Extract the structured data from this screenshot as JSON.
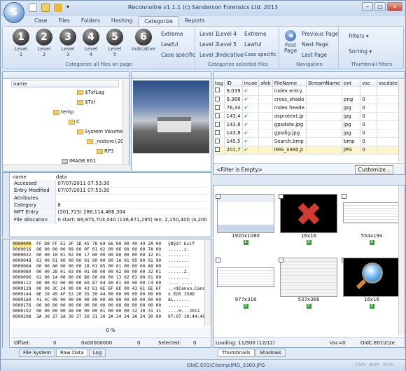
{
  "window": {
    "title": "Reconnoitre v1.1.1 (c) Sanderson Forensics Ltd. 2013"
  },
  "tabs": [
    "Case",
    "Files",
    "Folders",
    "Hashing",
    "Categorize",
    "Reports"
  ],
  "ribbon": {
    "levels": [
      {
        "num": "1",
        "label": "Level\n1"
      },
      {
        "num": "2",
        "label": "Level\n2"
      },
      {
        "num": "3",
        "label": "Level\n3"
      },
      {
        "num": "4",
        "label": "Level\n4"
      },
      {
        "num": "5",
        "label": "Level\n5"
      },
      {
        "num": "6",
        "label": "Indicative"
      }
    ],
    "extreme": "Extreme",
    "lawful": "Lawful",
    "case_specific": "Case specific",
    "group1_label": "Categorize all files on page",
    "sel_levels": [
      "Level 1",
      "Level 4",
      "Level 2",
      "Level 5",
      "Level 3",
      "Indicative"
    ],
    "group2_label": "Categorize selected files",
    "first_page": "First\nPage",
    "prev_page": "Previous Page",
    "next_page": "Next Page",
    "last_page": "Last Page",
    "nav_label": "Navigation",
    "filters": "Filters",
    "sorting": "Sorting",
    "thumb_label": "Thumbnail filters"
  },
  "tree": {
    "header": "name",
    "rows": [
      "$TxfLog",
      "$Txf",
      "temp",
      "C",
      "System Volume In",
      "_restore{2O",
      "RP3",
      "IMAGE.E01"
    ]
  },
  "files": {
    "columns": [
      "tag",
      "ID",
      "inuse",
      "sfok",
      "FileName",
      "StreamName",
      "ext",
      "vsc",
      "vscdate"
    ],
    "rows": [
      [
        "9,039",
        "index entry.",
        "",
        "",
        ""
      ],
      [
        "9,388",
        "cross_shado",
        "",
        "png",
        "0"
      ],
      [
        "76,34",
        "index heade",
        "",
        "jpg",
        "0"
      ],
      [
        "143,4",
        "asprotext.jp",
        "",
        "jpg",
        "0"
      ],
      [
        "143,8",
        "gpsdate.jpg",
        "",
        "jpg",
        "0"
      ],
      [
        "143,8",
        "gpsdig.jpg",
        "",
        "jpg",
        "0"
      ],
      [
        "145,5",
        "Search.bmp",
        "",
        "bmp",
        "0"
      ],
      [
        "201,7",
        "IMG_3360.JI",
        "",
        "JPG",
        "0"
      ]
    ],
    "filter": "<Filter is Empty>",
    "customize": "Customize..."
  },
  "props": {
    "header": [
      "name",
      "data"
    ],
    "rows": [
      [
        "Accessed",
        "07/07/2011 07:53:30"
      ],
      [
        "Entry Modified",
        "07/07/2011 07:53:30"
      ],
      [
        "Attributes",
        ""
      ],
      [
        "Category",
        "8"
      ],
      [
        "MFT Entry",
        "(201,723) 286,114,466,304"
      ],
      [
        "File allocation",
        "0 start: 69,975,703,040 (136,671,295) len: 2,150,400 (4,200"
      ]
    ]
  },
  "hex": {
    "offsets": [
      "0000000",
      "0000016",
      "0000032",
      "0000048",
      "0000064",
      "0000080",
      "0000096",
      "0000112",
      "0000128",
      "0000144",
      "0000160",
      "0000176",
      "0000192",
      "0000208"
    ],
    "bytes": [
      "FF D8 FF E1 3F 1D 45 78 69 66 00 00 49 49 2A 00",
      "08 00 00 00 09 00 0F 01 02 00 06 00 00 00 7A 00",
      "00 00 10 01 02 00 17 00 00 00 80 00 00 00 12 01",
      "03 00 01 00 00 00 01 00 00 00 1A 01 05 00 01 00",
      "00 00 A0 00 00 00 1B 01 05 00 01 00 00 00 A8 00",
      "00 00 28 01 03 00 01 00 00 00 02 00 00 00 32 01",
      "02 00 14 00 00 00 B0 00 00 00 13 02 03 00 01 00",
      "00 00 02 00 00 00 69 87 04 00 01 00 00 00 C4 00",
      "00 00 3C 24 00 00 43 61 6E 6F 6E 00 43 61 6E 6F",
      "6E 20 45 4F 53 20 35 30 44 00 00 00 00 00 00 00",
      "41 4C 00 00 00 00 00 00 00 00 00 00 00 00 00 00",
      "00 00 00 00 00 00 00 00 00 00 00 00 00 00 00 00",
      "00 00 00 00 48 00 00 00 01 00 00 00 32 30 31 31",
      "3A 30 37 3A 30 37 20 31 30 3A 34 34 3A 34 30 00"
    ],
    "ascii": [
      "ÿØÿá? Exif",
      "......z.",
      "........",
      "........",
      "........",
      "......2.",
      "........",
      "........",
      "..<$Canon.Cano",
      "n EOS 350D",
      "AL......",
      "........",
      "....H...2011",
      "07:07 10:44:40."
    ],
    "percent": "0 %",
    "offset_label": "Offset:",
    "offset_val": "0",
    "hex_val": "0x00000000",
    "hex_dec": "0",
    "selected_label": "Selected:",
    "selected_val": "0"
  },
  "left_tabs": [
    "File System",
    "Raw Data",
    "Log"
  ],
  "thumbs": [
    {
      "label": "1920x1080",
      "count": "8"
    },
    {
      "label": "16x16",
      "count": "8"
    },
    {
      "label": "554x194",
      "count": "8"
    },
    {
      "label": "977x316",
      "count": "8"
    },
    {
      "label": "537x366",
      "count": "8"
    },
    {
      "label": "16x16",
      "count": "8"
    }
  ],
  "thumb_status": {
    "loading": "Loading: 11/500 (12/12)",
    "vsc": "Vsc=0",
    "path": "OldC.E01\\C\\te"
  },
  "right_tabs": [
    "Thumbnails",
    "Shadows"
  ],
  "statusbar": {
    "path": "OldC.E01\\C\\temp\\IMG_3360.JPG",
    "caps": "CAPS",
    "num": "NUM",
    "scrl": "SCRL"
  }
}
